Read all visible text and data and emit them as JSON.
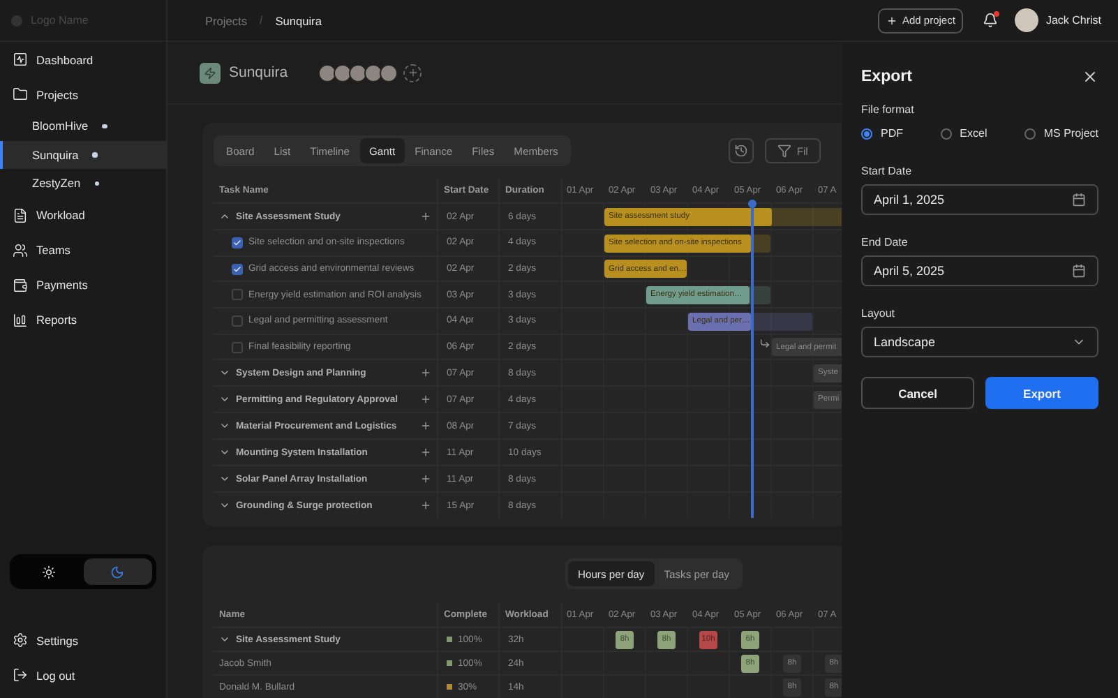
{
  "sidebar": {
    "logo": "Logo Name",
    "items": [
      {
        "label": "Dashboard",
        "selected": false
      },
      {
        "label": "Projects",
        "selected": false,
        "children": [
          {
            "label": "BloomHive",
            "selected": false
          },
          {
            "label": "Sunquira",
            "selected": true
          },
          {
            "label": "ZestyZen",
            "selected": false
          }
        ]
      },
      {
        "label": "Workload",
        "selected": false
      },
      {
        "label": "Teams",
        "selected": false
      },
      {
        "label": "Payments",
        "selected": false
      },
      {
        "label": "Reports",
        "selected": false
      }
    ],
    "theme_toggle": [
      {
        "kind": "sun",
        "selected": false
      },
      {
        "kind": "moon",
        "selected": true
      }
    ],
    "footer": [
      "Settings",
      "Log out"
    ]
  },
  "topbar": {
    "breadcrumbs": [
      "Projects",
      "Sunquira"
    ],
    "separator": "/",
    "add_button": "Add project",
    "unread_notifications": true,
    "user_name": "Jack Christ"
  },
  "project": {
    "name": "Sunquira"
  },
  "gantt": {
    "tabs": [
      {
        "label": "Board",
        "selected": false
      },
      {
        "label": "List",
        "selected": false
      },
      {
        "label": "Timeline",
        "selected": false
      },
      {
        "label": "Gantt",
        "selected": true
      },
      {
        "label": "Finance",
        "selected": false
      },
      {
        "label": "Files",
        "selected": false
      },
      {
        "label": "Members",
        "selected": false
      }
    ],
    "filter_label": "Fil",
    "columns": [
      "Task Name",
      "Start Date",
      "Duration"
    ],
    "days": [
      "01 Apr",
      "02 Apr",
      "03 Apr",
      "04 Apr",
      "05 Apr",
      "06 Apr",
      "07 A"
    ],
    "tasks": [
      {
        "name": "Site Assessment Study",
        "start": "02 Apr",
        "duration": "6 days",
        "expanded": true,
        "bar": {
          "label": "Site assessment study",
          "color": "#b8901f",
          "level": 0.67
        },
        "children": [
          {
            "name": "Site selection and on-site inspections",
            "start": "02 Apr",
            "duration": "4 days",
            "checked": true,
            "dependency": false,
            "bar": {
              "label": "Site selection and on-site inspections",
              "color": "#b8901f",
              "level": 0.88
            }
          },
          {
            "name": "Grid access and environmental reviews",
            "start": "02 Apr",
            "duration": "2 days",
            "checked": true,
            "dependency": false,
            "bar": {
              "label": "Grid access and en…",
              "color": "#b8901f",
              "level": 1
            }
          },
          {
            "name": "Energy yield estimation and ROI analysis",
            "start": "03 Apr",
            "duration": "3 days",
            "checked": false,
            "dependency": false,
            "bar": {
              "label": "Energy yield estimation…",
              "color": "#6f9c8c",
              "level": 0.83
            }
          },
          {
            "name": "Legal and permitting assessment",
            "start": "04 Apr",
            "duration": "3 days",
            "checked": false,
            "dependency": false,
            "bar": {
              "label": "Legal and per…",
              "color": "#6a6fb0",
              "level": 0.5
            }
          },
          {
            "name": "Final feasibility reporting",
            "start": "06 Apr",
            "duration": "2 days",
            "checked": false,
            "dependency": true,
            "bar": {
              "label": "Legal and permit",
              "color": "#3a3a3a",
              "level": 0
            }
          }
        ]
      },
      {
        "name": "System Design and Planning",
        "start": "07 Apr",
        "duration": "8 days",
        "expanded": false,
        "bar": {
          "label": "Syste",
          "color": "#3a3a3a",
          "level": 0
        }
      },
      {
        "name": "Permitting and Regulatory Approval",
        "start": "07 Apr",
        "duration": "4 days",
        "expanded": false,
        "bar": {
          "label": "Permi",
          "color": "#3a3a3a",
          "level": 0
        }
      },
      {
        "name": "Material Procurement and Logistics",
        "start": "08 Apr",
        "duration": "7 days",
        "expanded": false
      },
      {
        "name": "Mounting System Installation",
        "start": "11 Apr",
        "duration": "10 days",
        "expanded": false
      },
      {
        "name": "Solar Panel Array Installation",
        "start": "11 Apr",
        "duration": "8 days",
        "expanded": false
      },
      {
        "name": "Grounding & Surge protection",
        "start": "15 Apr",
        "duration": "8 days",
        "expanded": false
      }
    ]
  },
  "workload": {
    "tabs": [
      {
        "label": "Hours per day",
        "selected": true
      },
      {
        "label": "Tasks per day",
        "selected": false
      }
    ],
    "columns": [
      "Name",
      "Complete",
      "Workload"
    ],
    "days": [
      "01 Apr",
      "02 Apr",
      "03 Apr",
      "04 Apr",
      "05 Apr",
      "06 Apr",
      "07 A"
    ],
    "rows": [
      {
        "kind": "group",
        "expanded": true,
        "name": "Site Assessment Study",
        "complete": "100%",
        "color": "#7f9a6c",
        "workload": "32h",
        "hours": [
          {
            "text": "8h",
            "color": "#8ea379"
          },
          {
            "text": "8h",
            "color": "#8ea379"
          },
          {
            "text": "10h",
            "color": "#b54848"
          },
          {
            "text": "6h",
            "color": "#8ea379"
          }
        ]
      },
      {
        "kind": "person",
        "name": "Jacob Smith",
        "complete": "100%",
        "color": "#7f9a6c",
        "workload": "24h",
        "hours": [
          {
            "text": "8h",
            "color": "#8ea379"
          },
          {
            "text": "8h",
            "color": "#333333"
          },
          {
            "text": "8h",
            "color": "#333333"
          }
        ]
      },
      {
        "kind": "person",
        "name": "Donald M. Bullard",
        "complete": "30%",
        "color": "#b08a3a",
        "workload": "14h",
        "hours": [
          {
            "text": "8h",
            "color": "#333333"
          },
          {
            "text": "8h",
            "color": "#333333"
          }
        ]
      }
    ]
  },
  "export": {
    "title": "Export",
    "format_label": "File format",
    "formats": [
      {
        "label": "PDF",
        "selected": true
      },
      {
        "label": "Excel",
        "selected": false
      },
      {
        "label": "MS Project",
        "selected": false
      }
    ],
    "start_label": "Start Date",
    "start_value": "April 1, 2025",
    "end_label": "End Date",
    "end_value": "April 5, 2025",
    "layout_label": "Layout",
    "layout_value": "Landscape",
    "cancel": "Cancel",
    "submit": "Export"
  }
}
